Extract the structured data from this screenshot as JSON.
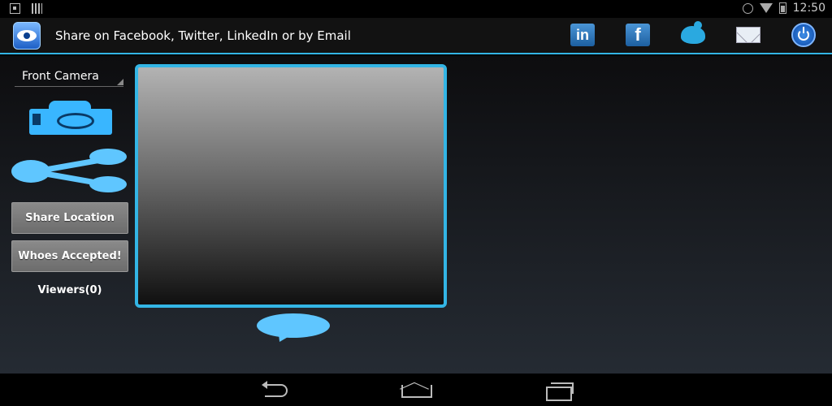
{
  "status_bar": {
    "time": "12:50",
    "icons": [
      "download-icon",
      "barcode-icon",
      "alarm-icon",
      "wifi-icon",
      "battery-icon"
    ]
  },
  "action_bar": {
    "title": "Share on Facebook, Twitter, LinkedIn or by Email",
    "app_icon": "eye-icon",
    "linkedin_label": "in",
    "facebook_label": "f",
    "social_icons": [
      "linkedin-icon",
      "facebook-icon",
      "twitter-icon",
      "email-icon",
      "power-icon"
    ]
  },
  "sidebar": {
    "camera_select": "Front Camera",
    "camera_icon": "camera-icon",
    "share_icon": "share-icon",
    "share_location_label": "Share Location",
    "whoes_accepted_label": "Whoes Accepted!",
    "viewers_text": "Viewers(0)"
  },
  "main": {
    "chat_icon": "chat-bubble-icon"
  },
  "nav_bar": {
    "buttons": [
      "back-icon",
      "home-icon",
      "recent-apps-icon"
    ]
  },
  "colors": {
    "accent": "#33b5e5",
    "icon_blue": "#5fc6ff",
    "button_gray": "#7a7a7a"
  }
}
